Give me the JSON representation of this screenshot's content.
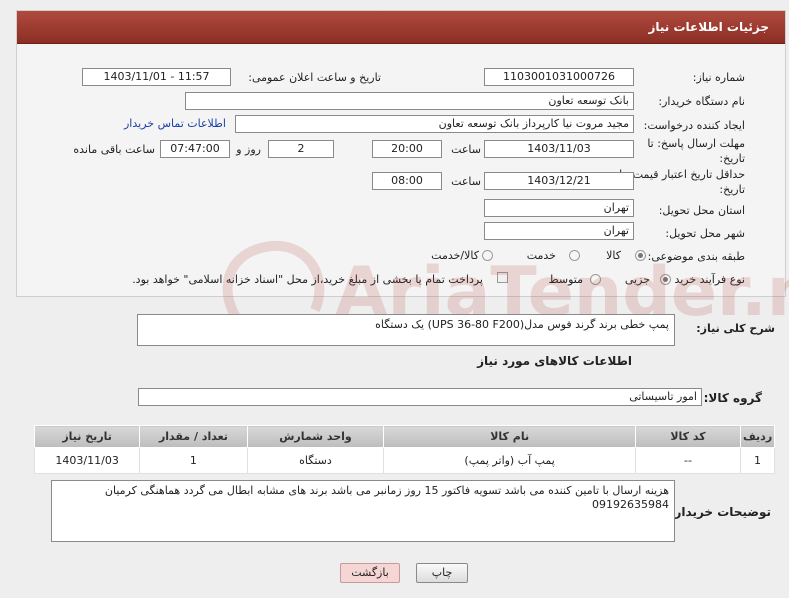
{
  "header": {
    "title": "جزئیات اطلاعات نیاز"
  },
  "form": {
    "need_number": {
      "label": "شماره نیاز:",
      "value": "1103001031000726"
    },
    "announce_datetime": {
      "label": "تاریخ و ساعت اعلان عمومی:",
      "value": "1403/11/01 - 11:57"
    },
    "buyer_org": {
      "label": "نام دستگاه خریدار:",
      "value": "بانک توسعه تعاون"
    },
    "requester": {
      "label": "ایجاد کننده درخواست:",
      "value": "مجید مروت نیا کارپرداز بانک توسعه تعاون",
      "contact_link": "اطلاعات تماس خریدار"
    },
    "reply_deadline": {
      "label": "مهلت ارسال پاسخ: تا تاریخ:",
      "date": "1403/11/03",
      "time_label": "ساعت",
      "time": "20:00",
      "days": "2",
      "days_label": "روز و",
      "remaining_time": "07:47:00",
      "remaining_label": "ساعت باقی مانده"
    },
    "price_validity": {
      "label": "حداقل تاریخ اعتبار قیمت: تا تاریخ:",
      "date": "1403/12/21",
      "time_label": "ساعت",
      "time": "08:00"
    },
    "delivery_province": {
      "label": "استان محل تحویل:",
      "value": "تهران"
    },
    "delivery_city": {
      "label": "شهر محل تحویل:",
      "value": "تهران"
    },
    "category": {
      "label": "طبقه بندی موضوعی:",
      "options": [
        "کالا",
        "خدمت",
        "کالا/خدمت"
      ],
      "selected": "کالا"
    },
    "purchase_type": {
      "label": "نوع فرآیند خرید :",
      "options": [
        "جزیی",
        "متوسط"
      ],
      "selected": "جزیی",
      "payment_note": "پرداخت تمام یا بخشی از مبلغ خرید،از محل \"اسناد خزانه اسلامی\" خواهد بود."
    }
  },
  "description": {
    "label": "شرح کلی نیاز:",
    "value": "پمپ خطی برند گرند فوس مدل(UPS 36-80 F200) یک دستگاه"
  },
  "goods_section": {
    "title": "اطلاعات کالاهای مورد نیاز"
  },
  "goods_group": {
    "label": "گروه کالا:",
    "value": "امور تاسیساتی"
  },
  "table": {
    "headers": [
      "ردیف",
      "کد کالا",
      "نام کالا",
      "واحد شمارش",
      "تعداد / مقدار",
      "تاریخ نیاز"
    ],
    "rows": [
      [
        "1",
        "--",
        "پمپ آب (واتر پمپ)",
        "دستگاه",
        "1",
        "1403/11/03"
      ]
    ]
  },
  "buyer_notes": {
    "label": "توضیحات خریدار:",
    "value": "هزینه ارسال با تامین کننده می باشد تسویه فاکتور 15 روز زمانبر می باشد برند های مشابه ابطال می گردد هماهنگی کرمیان 09192635984"
  },
  "buttons": {
    "print": "چاپ",
    "back": "بازگشت"
  },
  "watermark": {
    "text": "AriaTender.neT"
  }
}
